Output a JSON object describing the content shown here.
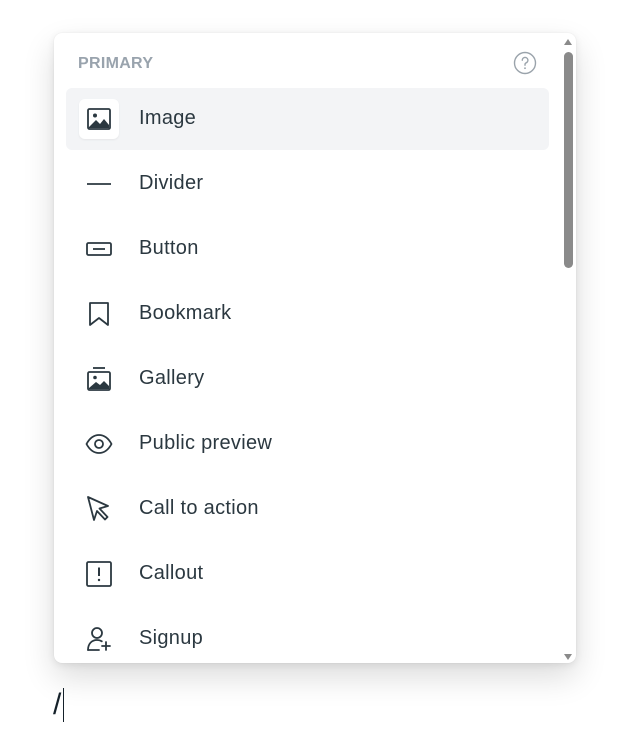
{
  "menu": {
    "section_title": "PRIMARY",
    "help_icon": "question-circle-icon",
    "items": [
      {
        "label": "Image",
        "icon": "image-icon",
        "selected": true
      },
      {
        "label": "Divider",
        "icon": "divider-icon",
        "selected": false
      },
      {
        "label": "Button",
        "icon": "button-icon",
        "selected": false
      },
      {
        "label": "Bookmark",
        "icon": "bookmark-icon",
        "selected": false
      },
      {
        "label": "Gallery",
        "icon": "gallery-icon",
        "selected": false
      },
      {
        "label": "Public preview",
        "icon": "eye-icon",
        "selected": false
      },
      {
        "label": "Call to action",
        "icon": "cursor-arrow-icon",
        "selected": false
      },
      {
        "label": "Callout",
        "icon": "exclamation-box-icon",
        "selected": false
      },
      {
        "label": "Signup",
        "icon": "user-add-icon",
        "selected": false
      }
    ]
  },
  "editor": {
    "text": "/"
  },
  "colors": {
    "section_title": "#99a3ad",
    "item_text": "#2b3840",
    "selected_bg": "#f3f4f6",
    "scrollbar": "#8a8a8a"
  }
}
